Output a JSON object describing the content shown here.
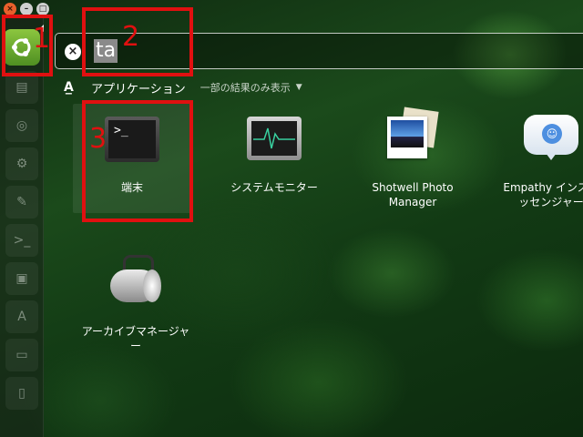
{
  "window_controls": {
    "close": "×",
    "minimize": "–",
    "maximize": "□"
  },
  "launcher": {
    "items": [
      {
        "name": "files-icon",
        "glyph": "▤"
      },
      {
        "name": "firefox-icon",
        "glyph": "◎"
      },
      {
        "name": "settings-icon",
        "glyph": "⚙"
      },
      {
        "name": "text-editor-icon",
        "glyph": "✎"
      },
      {
        "name": "terminal-icon",
        "glyph": ">_"
      },
      {
        "name": "screenshot-icon",
        "glyph": "▣"
      },
      {
        "name": "software-center-icon",
        "glyph": "A"
      },
      {
        "name": "disk-icon",
        "glyph": "▭"
      },
      {
        "name": "usb-icon",
        "glyph": "▯"
      }
    ]
  },
  "search": {
    "query": "ta"
  },
  "filter": {
    "category_label": "アプリケーション",
    "partial_results": "一部の結果のみ表示",
    "caret": "▼"
  },
  "apps": [
    {
      "label": "端末"
    },
    {
      "label": "システムモニター"
    },
    {
      "label": "Shotwell Photo\nManager"
    },
    {
      "label": "Empathy インスタ\nッセンジャー"
    },
    {
      "label": "アーカイブマネージャー"
    }
  ],
  "annotations": {
    "n1": "1",
    "n2": "2",
    "n3": "3",
    "color": "#e01010"
  }
}
